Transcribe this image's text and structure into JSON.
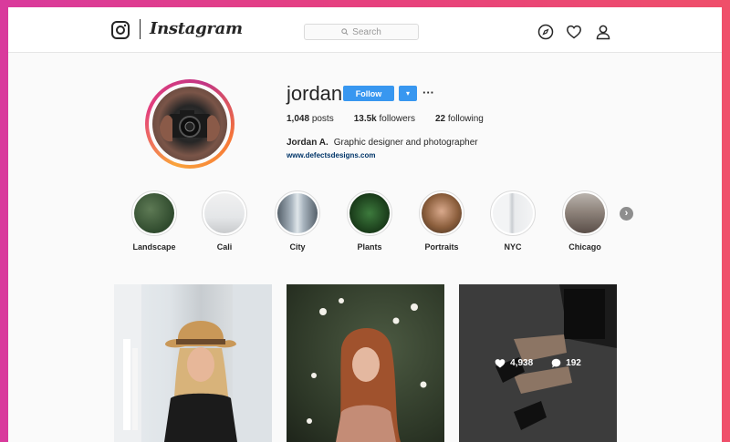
{
  "header": {
    "wordmark": "Instagram",
    "search_placeholder": "Search",
    "icons": [
      "instagram-camera-icon",
      "search-icon",
      "explore-compass-icon",
      "activity-heart-icon",
      "profile-person-icon"
    ]
  },
  "profile": {
    "username": "jordan",
    "follow_label": "Follow",
    "dropdown_glyph": "▾",
    "more_glyph": "···",
    "stats": {
      "posts_count": "1,048",
      "posts_label": "posts",
      "followers_count": "13.5k",
      "followers_label": "followers",
      "following_count": "22",
      "following_label": "following"
    },
    "full_name": "Jordan A.",
    "bio": "Graphic designer and photographer",
    "website": "www.defectsdesigns.com"
  },
  "highlights": [
    {
      "label": "Landscape"
    },
    {
      "label": "Cali"
    },
    {
      "label": "City"
    },
    {
      "label": "Plants"
    },
    {
      "label": "Portraits"
    },
    {
      "label": "NYC"
    },
    {
      "label": "Chicago"
    }
  ],
  "highlights_next_glyph": "›",
  "posts": [
    {
      "likes": "",
      "comments": ""
    },
    {
      "likes": "",
      "comments": ""
    },
    {
      "likes": "4,938",
      "comments": "192"
    }
  ],
  "colors": {
    "accent": "#3897f0",
    "link": "#003569",
    "text": "#262626",
    "background_gradient_start": "#d93a9c",
    "background_gradient_end": "#ef4f6a"
  }
}
